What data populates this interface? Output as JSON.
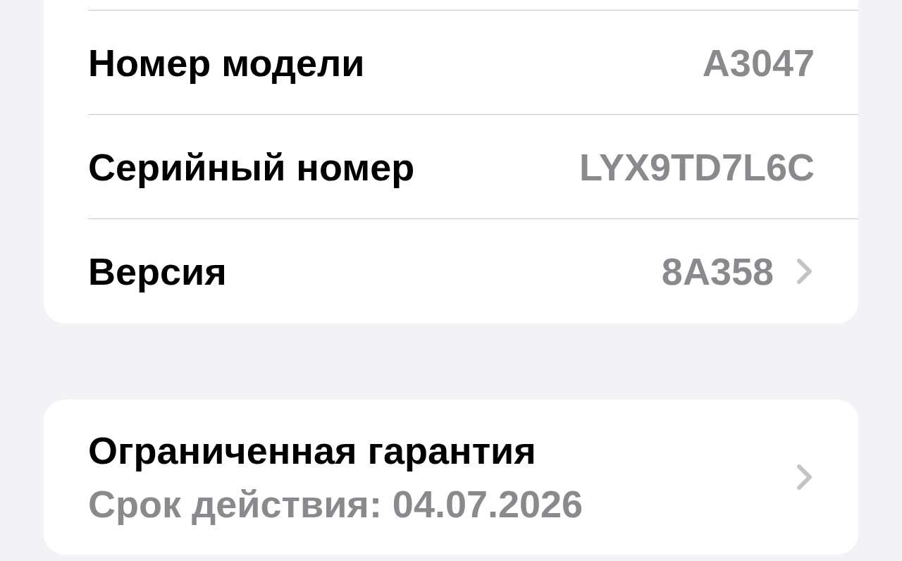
{
  "device_info": {
    "rows": [
      {
        "label": "Номер модели",
        "value": "A3047",
        "chevron": false
      },
      {
        "label": "Серийный номер",
        "value": "LYX9TD7L6C",
        "chevron": false
      },
      {
        "label": "Версия",
        "value": "8A358",
        "chevron": true
      }
    ]
  },
  "warranty": {
    "title": "Ограниченная гарантия",
    "subtitle": "Срок действия: 04.07.2026",
    "chevron": true
  }
}
